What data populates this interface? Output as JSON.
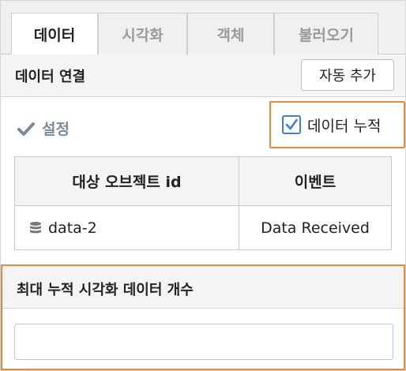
{
  "tabs": [
    {
      "label": "데이터",
      "active": true
    },
    {
      "label": "시각화",
      "active": false
    },
    {
      "label": "객체",
      "active": false
    },
    {
      "label": "불러오기",
      "active": false
    }
  ],
  "data_connection": {
    "title": "데이터 연결",
    "auto_add_label": "자동 추가"
  },
  "settings": {
    "label": "설정",
    "icon": "checkmark-icon"
  },
  "accumulate": {
    "label": "데이터 누적",
    "checked": true
  },
  "table": {
    "headers": [
      "대상 오브젝트 id",
      "이벤트"
    ],
    "rows": [
      {
        "object_id": "data-2",
        "event": "Data Received",
        "icon": "database-icon"
      }
    ]
  },
  "max_accumulate": {
    "title": "최대 누적 시각화 데이터 개수",
    "value": "",
    "placeholder": ""
  },
  "colors": {
    "highlight": "#e58a3c",
    "checkbox": "#3e7ed8",
    "muted_text": "#9a9a9a",
    "settings_text": "#7c8a99"
  }
}
